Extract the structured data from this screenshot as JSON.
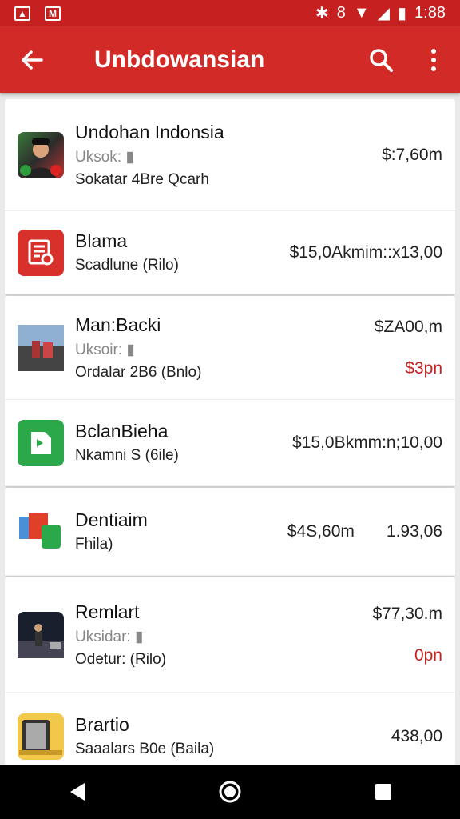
{
  "status_bar": {
    "icons_left": [
      "image-icon",
      "mail-icon"
    ],
    "icons_right": [
      "bluetooth-icon",
      "vibrate-icon",
      "wifi-icon",
      "signal-icon",
      "battery-icon"
    ],
    "time": "1:88"
  },
  "app_bar": {
    "title": "Unbdowansian",
    "back_icon": "arrow-back-icon",
    "search_icon": "search-icon",
    "more_icon": "more-vert-icon",
    "color": "#d22a26"
  },
  "items": [
    {
      "name": "Undohan Indonsia",
      "sub1": "Uksok: ",
      "sub2": "Sokatar 4Bre Qcarh",
      "amount1": "$:7,60m",
      "amount2": ""
    },
    {
      "name": "Blama",
      "sub1": "",
      "sub2": "Scadlune (Rilo)",
      "amount1": "$15,0Akmim::x13,00",
      "amount2": ""
    },
    {
      "name": "Man:Backi",
      "sub1": "Uksoir: ",
      "sub2": "Ordalar 2B6 (Bnlo)",
      "amount1": "$ZA00,m",
      "amount2": "$3pn"
    },
    {
      "name": "BclanBieha",
      "sub1": "",
      "sub2": "Nkamni S (6ile)",
      "amount1": "$15,0Bkmm:n;10,00",
      "amount2": ""
    },
    {
      "name": "Dentiaim",
      "sub1": "",
      "sub2": "Fhila)",
      "amount1": "$4S,60m",
      "amount1b": "1.93,06",
      "amount2": ""
    },
    {
      "name": "Remlart",
      "sub1": "Uksidar: ",
      "sub2": "Odetur: (Rilo)",
      "amount1": "$77,30.m",
      "amount2": "0pn"
    },
    {
      "name": "Brartio",
      "sub1": "",
      "sub2": "Saaalars B0e (Baila)",
      "amount1": "438,00",
      "amount2": ""
    }
  ],
  "nav": {
    "back": "back-triangle-icon",
    "home": "home-circle-icon",
    "recents": "recents-square-icon"
  }
}
